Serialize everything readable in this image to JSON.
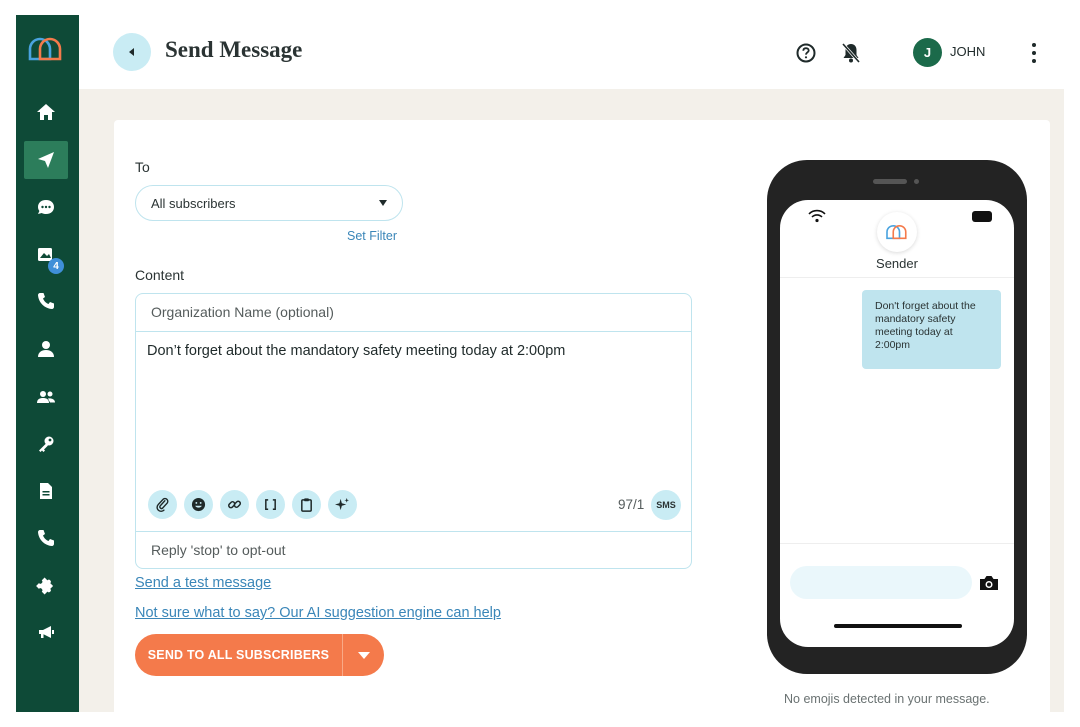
{
  "header": {
    "title": "Send Message",
    "user_initial": "J",
    "user_name": "JOHN"
  },
  "sidebar": {
    "badge_count": "4",
    "items": [
      {
        "name": "home",
        "icon": "home-icon"
      },
      {
        "name": "send",
        "icon": "send-icon",
        "active": true
      },
      {
        "name": "chat",
        "icon": "chat-icon"
      },
      {
        "name": "media",
        "icon": "image-icon"
      },
      {
        "name": "calls",
        "icon": "phone-icon"
      },
      {
        "name": "contact",
        "icon": "person-icon"
      },
      {
        "name": "groups",
        "icon": "people-icon"
      },
      {
        "name": "keys",
        "icon": "key-icon"
      },
      {
        "name": "documents",
        "icon": "document-icon"
      },
      {
        "name": "voice",
        "icon": "phone-icon"
      },
      {
        "name": "integrations",
        "icon": "puzzle-icon"
      },
      {
        "name": "broadcast",
        "icon": "megaphone-icon"
      }
    ]
  },
  "form": {
    "to_label": "To",
    "to_value": "All subscribers",
    "set_filter": "Set Filter",
    "content_label": "Content",
    "org_placeholder": "Organization Name (optional)",
    "message": "Don’t forget about the mandatory safety meeting today at 2:00pm",
    "counter": "97/1",
    "sms_label": "SMS",
    "opt_out": "Reply 'stop' to opt-out",
    "test_link": "Send a test message",
    "ai_link": "Not sure what to say? Our AI suggestion engine can help",
    "send_label": "SEND TO ALL SUBSCRIBERS"
  },
  "preview": {
    "sender": "Sender",
    "bubble": "Don't forget about the mandatory safety meeting today at 2:00pm",
    "emoji_note": "No emojis detected in your message."
  },
  "colors": {
    "sidebar": "#0e4a37",
    "accent": "#f47a4b",
    "light_blue": "#c9ecf4",
    "link": "#3a86b8"
  }
}
